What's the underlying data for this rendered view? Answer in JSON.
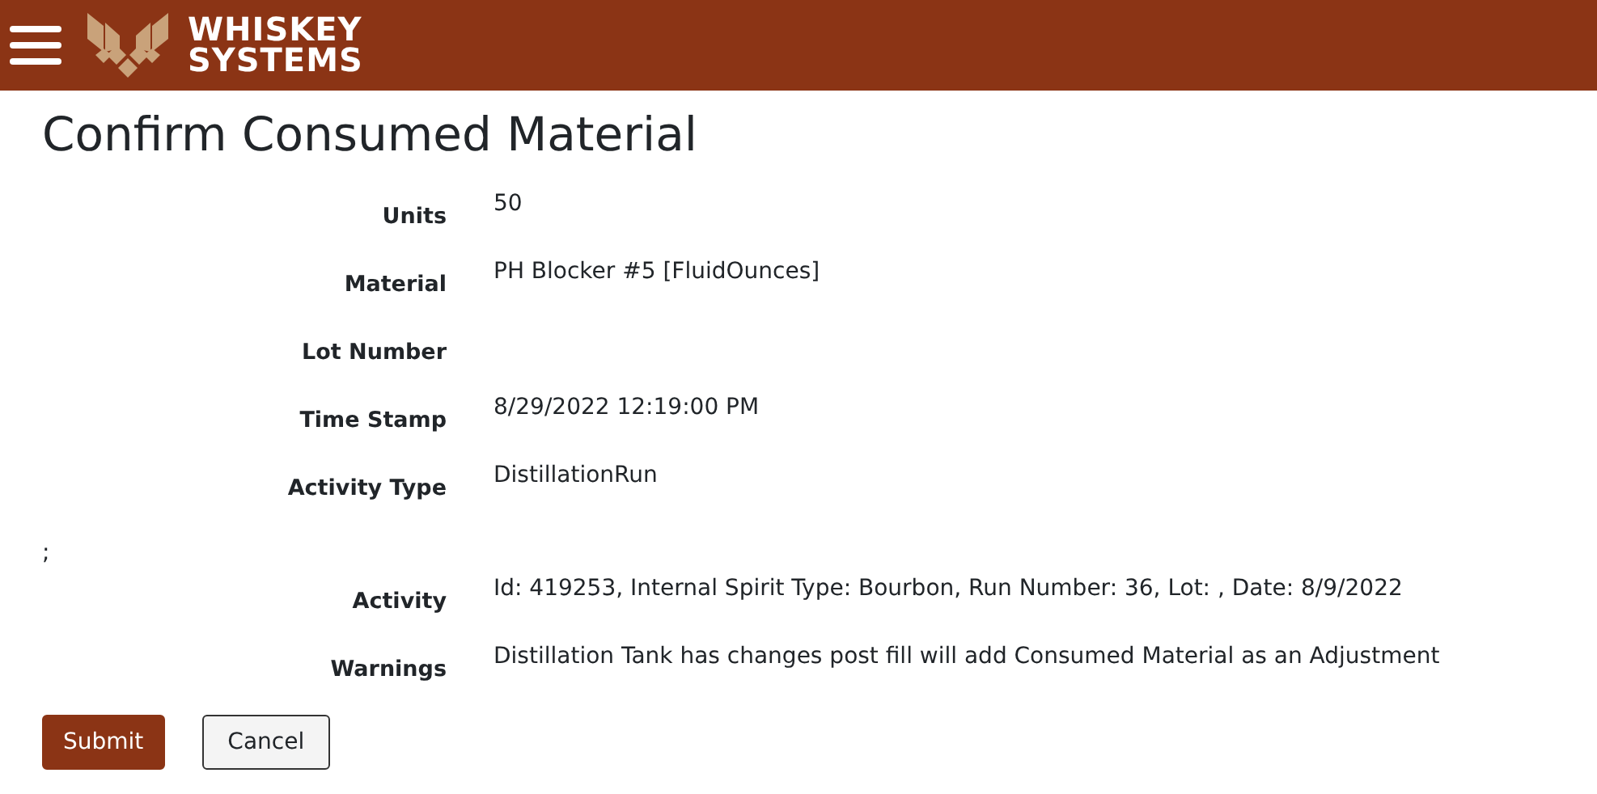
{
  "header": {
    "brand_line_1": "WHISKEY",
    "brand_line_2": "SYSTEMS"
  },
  "title": "Confirm Consumed Material",
  "fields": [
    {
      "label": "Units",
      "value": "50"
    },
    {
      "label": "Material",
      "value": "PH Blocker #5 [FluidOunces]"
    },
    {
      "label": "Lot Number"
    },
    {
      "label": "Time Stamp",
      "value": "8/29/2022 12:19:00 PM"
    },
    {
      "label": "Activity Type",
      "value": "DistillationRun"
    }
  ],
  "stray_text": ";",
  "fields_2": [
    {
      "label": "Activity",
      "value": "Id: 419253, Internal Spirit Type: Bourbon, Run Number: 36, Lot: , Date: 8/9/2022"
    },
    {
      "label": "Warnings",
      "value": "Distillation Tank has changes post fill will add Consumed Material as an Adjustment"
    }
  ],
  "buttons": [
    {
      "label": "Submit",
      "kind": "primary"
    },
    {
      "label": "Cancel",
      "kind": "secondary"
    }
  ]
}
